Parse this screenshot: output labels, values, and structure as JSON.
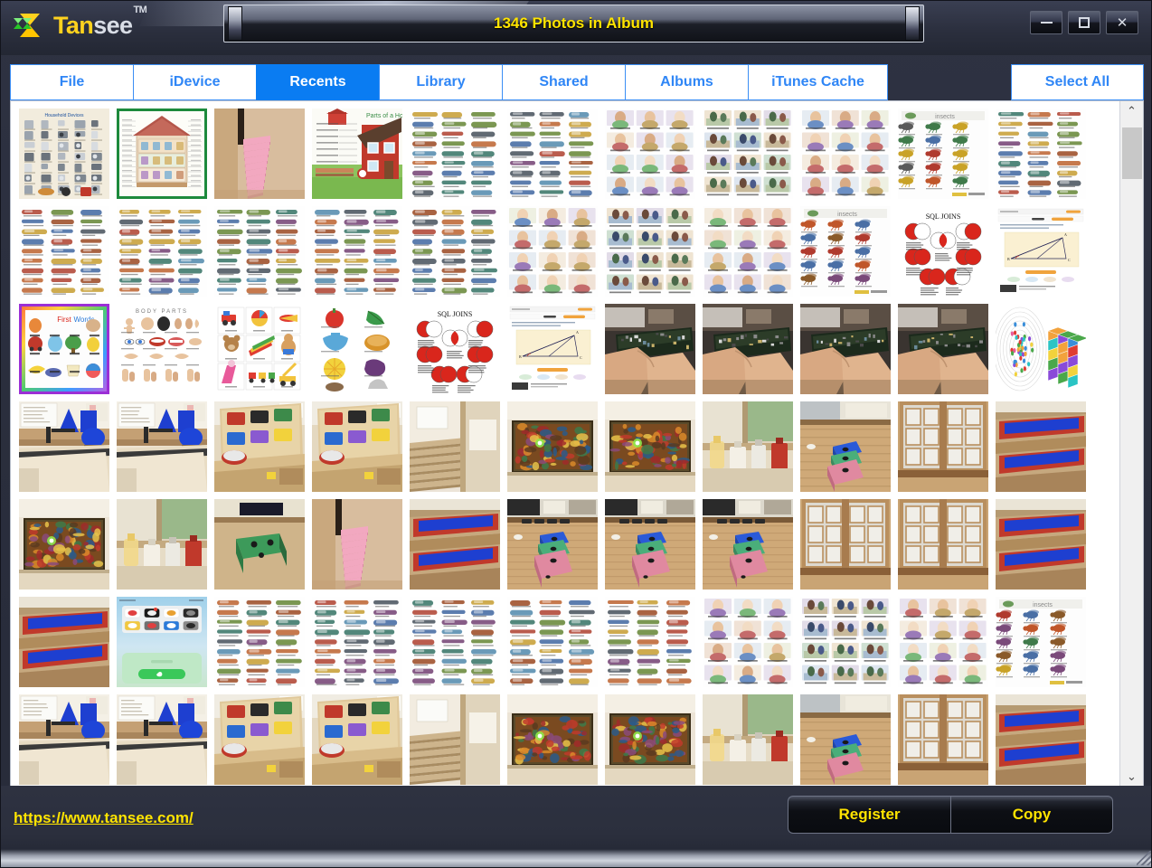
{
  "window": {
    "title": "1346 Photos in Album",
    "brand_name_part1": "Tan",
    "brand_name_part2": "see",
    "brand_tm": "TM",
    "minimize_label": "",
    "maximize_label": "",
    "close_label": "✕",
    "accent_yellow": "#ffe400",
    "accent_blue": "#0a7cf2",
    "tab_blue": "#2f86f6"
  },
  "tabs": [
    {
      "label": "File",
      "active": false
    },
    {
      "label": "iDevice",
      "active": false
    },
    {
      "label": "Recents",
      "active": true
    },
    {
      "label": "Library",
      "active": false
    },
    {
      "label": "Shared",
      "active": false
    },
    {
      "label": "Albums",
      "active": false
    },
    {
      "label": "iTunes Cache",
      "active": false
    }
  ],
  "select_all": {
    "label": "Select All"
  },
  "footer": {
    "url": "https://www.tansee.com/",
    "register_label": "Register",
    "copy_label": "Copy"
  },
  "scrollbar": {
    "up_arrow": "⌃",
    "down_arrow": "⌄",
    "thumb_position_pct": 1,
    "thumb_size_pct": 8
  },
  "grid": {
    "columns": 11,
    "rows": 7,
    "thumbnails": [
      {
        "id": "r1c1",
        "kind": "poster-appliances",
        "selected": null,
        "caption": "Household Devices and Appliances"
      },
      {
        "id": "r1c2",
        "kind": "poster-house-cut",
        "selected": "green",
        "caption": "House cutaway diagram"
      },
      {
        "id": "r1c3",
        "kind": "photo-pink-stack",
        "selected": null,
        "caption": "Pink stacking blocks"
      },
      {
        "id": "r1c4",
        "kind": "poster-parts-house",
        "selected": null,
        "caption": "Parts of a House"
      },
      {
        "id": "r1c5",
        "kind": "poster-vocab-rows",
        "selected": null,
        "caption": "Vocabulary chart"
      },
      {
        "id": "r1c6",
        "kind": "poster-vocab-rows",
        "selected": null,
        "caption": "Vocabulary chart"
      },
      {
        "id": "r1c7",
        "kind": "poster-routine",
        "selected": null,
        "caption": "Daily routine chart"
      },
      {
        "id": "r1c8",
        "kind": "poster-routine2",
        "selected": null,
        "caption": "Daily routine chart"
      },
      {
        "id": "r1c9",
        "kind": "poster-routine",
        "selected": null,
        "caption": "Daily routine chart"
      },
      {
        "id": "r1c10",
        "kind": "poster-insects",
        "selected": null,
        "caption": "Insects chart"
      },
      {
        "id": "r1c11",
        "kind": "poster-vocab-rows",
        "selected": null,
        "caption": "Vocabulary chart"
      },
      {
        "id": "r2c1",
        "kind": "poster-vocab-rows",
        "selected": null,
        "caption": "Vocabulary chart"
      },
      {
        "id": "r2c2",
        "kind": "poster-vocab-rows",
        "selected": null,
        "caption": "Vocabulary chart"
      },
      {
        "id": "r2c3",
        "kind": "poster-vocab-rows",
        "selected": null,
        "caption": "Vocabulary chart"
      },
      {
        "id": "r2c4",
        "kind": "poster-vocab-rows",
        "selected": null,
        "caption": "Vocabulary chart"
      },
      {
        "id": "r2c5",
        "kind": "poster-vocab-rows",
        "selected": null,
        "caption": "Vocabulary chart"
      },
      {
        "id": "r2c6",
        "kind": "poster-routine",
        "selected": null,
        "caption": "Daily routine chart"
      },
      {
        "id": "r2c7",
        "kind": "poster-routine2",
        "selected": null,
        "caption": "Daily routine chart"
      },
      {
        "id": "r2c8",
        "kind": "poster-routine",
        "selected": null,
        "caption": "Daily routine chart"
      },
      {
        "id": "r2c9",
        "kind": "poster-insects",
        "selected": null,
        "caption": "Insects chart"
      },
      {
        "id": "r2c10",
        "kind": "poster-sqljoins",
        "selected": null,
        "caption": "SQL Joins diagram"
      },
      {
        "id": "r2c11",
        "kind": "screen-geometry",
        "selected": null,
        "caption": "Geometry webpage"
      },
      {
        "id": "r3c1",
        "kind": "poster-firstwords",
        "selected": "purple",
        "caption": "First Words chart"
      },
      {
        "id": "r3c2",
        "kind": "poster-bodyparts",
        "selected": null,
        "caption": "Body Parts chart"
      },
      {
        "id": "r3c3",
        "kind": "poster-toys",
        "selected": null,
        "caption": "Toys flashcards"
      },
      {
        "id": "r3c4",
        "kind": "poster-objects",
        "selected": null,
        "caption": "Objects flashcards"
      },
      {
        "id": "r3c5",
        "kind": "poster-sqljoins",
        "selected": null,
        "caption": "SQL Joins diagram"
      },
      {
        "id": "r3c6",
        "kind": "screen-geometry",
        "selected": null,
        "caption": "Geometry webpage"
      },
      {
        "id": "r3c7",
        "kind": "photo-hand-board",
        "selected": null,
        "caption": "Hand holding circuit board"
      },
      {
        "id": "r3c8",
        "kind": "photo-hand-board",
        "selected": null,
        "caption": "Hand holding circuit board"
      },
      {
        "id": "r3c9",
        "kind": "photo-hand-board",
        "selected": null,
        "caption": "Hand holding circuit board"
      },
      {
        "id": "r3c10",
        "kind": "photo-hand-board",
        "selected": null,
        "caption": "Hand holding circuit board"
      },
      {
        "id": "r3c11",
        "kind": "diagram-cubes",
        "selected": null,
        "caption": "Colorful cube diagram"
      },
      {
        "id": "r4c1",
        "kind": "photo-classroom-a",
        "selected": null,
        "caption": "Classroom shelf with blue shapes"
      },
      {
        "id": "r4c2",
        "kind": "photo-classroom-a",
        "selected": null,
        "caption": "Classroom shelf with blue shapes"
      },
      {
        "id": "r4c3",
        "kind": "photo-puzzle-board",
        "selected": null,
        "caption": "Wooden puzzle board"
      },
      {
        "id": "r4c4",
        "kind": "photo-puzzle-board",
        "selected": null,
        "caption": "Wooden puzzle board"
      },
      {
        "id": "r4c5",
        "kind": "photo-stairs",
        "selected": null,
        "caption": "Stairs with wall art"
      },
      {
        "id": "r4c6",
        "kind": "photo-wall-art",
        "selected": null,
        "caption": "Framed wall painting"
      },
      {
        "id": "r4c7",
        "kind": "photo-wall-art",
        "selected": null,
        "caption": "Framed wall painting"
      },
      {
        "id": "r4c8",
        "kind": "photo-bottles",
        "selected": null,
        "caption": "Bottles on table"
      },
      {
        "id": "r4c9",
        "kind": "photo-color-cubes",
        "selected": null,
        "caption": "Colored cubes on floor"
      },
      {
        "id": "r4c10",
        "kind": "photo-cabinet",
        "selected": null,
        "caption": "Glass cabinet doors"
      },
      {
        "id": "r4c11",
        "kind": "photo-redblue-step",
        "selected": null,
        "caption": "Red and blue step blocks"
      },
      {
        "id": "r5c1",
        "kind": "photo-wall-art",
        "selected": null,
        "caption": "Framed wall painting"
      },
      {
        "id": "r5c2",
        "kind": "photo-bottles",
        "selected": null,
        "caption": "Bottles on table"
      },
      {
        "id": "r5c3",
        "kind": "photo-green-box",
        "selected": null,
        "caption": "Green box on table"
      },
      {
        "id": "r5c4",
        "kind": "photo-pink-stack",
        "selected": null,
        "caption": "Pink stacking blocks"
      },
      {
        "id": "r5c5",
        "kind": "photo-redblue-step",
        "selected": null,
        "caption": "Red and blue step blocks"
      },
      {
        "id": "r5c6",
        "kind": "photo-boxes-stack",
        "selected": null,
        "caption": "Stacked colored boxes"
      },
      {
        "id": "r5c7",
        "kind": "photo-boxes-stack",
        "selected": null,
        "caption": "Stacked colored boxes"
      },
      {
        "id": "r5c8",
        "kind": "photo-boxes-stack",
        "selected": null,
        "caption": "Stacked colored boxes"
      },
      {
        "id": "r5c9",
        "kind": "photo-cabinet",
        "selected": null,
        "caption": "Glass cabinet doors"
      },
      {
        "id": "r5c10",
        "kind": "photo-cabinet",
        "selected": null,
        "caption": "Glass cabinet doors"
      },
      {
        "id": "r5c11",
        "kind": "photo-redblue-step",
        "selected": null,
        "caption": "Red and blue step blocks"
      },
      {
        "id": "r6c1",
        "kind": "photo-redblue-step",
        "selected": null,
        "caption": "Red and blue step blocks"
      },
      {
        "id": "r6c2",
        "kind": "screen-phone-call",
        "selected": null,
        "caption": "Phone app screenshot"
      },
      {
        "id": "r6c3",
        "kind": "poster-vocab-rows",
        "selected": null,
        "caption": "Vocabulary chart"
      },
      {
        "id": "r6c4",
        "kind": "poster-vocab-rows",
        "selected": null,
        "caption": "Vocabulary chart"
      },
      {
        "id": "r6c5",
        "kind": "poster-vocab-rows",
        "selected": null,
        "caption": "Vocabulary chart"
      },
      {
        "id": "r6c6",
        "kind": "poster-vocab-rows",
        "selected": null,
        "caption": "Vocabulary chart"
      },
      {
        "id": "r6c7",
        "kind": "poster-vocab-rows",
        "selected": null,
        "caption": "Vocabulary chart"
      },
      {
        "id": "r6c8",
        "kind": "poster-routine",
        "selected": null,
        "caption": "Daily routine chart"
      },
      {
        "id": "r6c9",
        "kind": "poster-routine2",
        "selected": null,
        "caption": "Daily routine chart"
      },
      {
        "id": "r6c10",
        "kind": "poster-routine",
        "selected": null,
        "caption": "Daily routine chart"
      },
      {
        "id": "r6c11",
        "kind": "poster-insects",
        "selected": null,
        "caption": "Insects chart"
      },
      {
        "id": "r7c1",
        "kind": "photo-classroom-a",
        "selected": null,
        "caption": "Classroom shelf with blue shapes"
      },
      {
        "id": "r7c2",
        "kind": "photo-classroom-a",
        "selected": null,
        "caption": "Classroom shelf with blue shapes"
      },
      {
        "id": "r7c3",
        "kind": "photo-puzzle-board",
        "selected": null,
        "caption": "Wooden puzzle board"
      },
      {
        "id": "r7c4",
        "kind": "photo-puzzle-board",
        "selected": null,
        "caption": "Wooden puzzle board"
      },
      {
        "id": "r7c5",
        "kind": "photo-stairs",
        "selected": null,
        "caption": "Stairs with wall art"
      },
      {
        "id": "r7c6",
        "kind": "photo-wall-art",
        "selected": null,
        "caption": "Framed wall painting"
      },
      {
        "id": "r7c7",
        "kind": "photo-wall-art",
        "selected": null,
        "caption": "Framed wall painting"
      },
      {
        "id": "r7c8",
        "kind": "photo-bottles",
        "selected": null,
        "caption": "Bottles on table"
      },
      {
        "id": "r7c9",
        "kind": "photo-color-cubes",
        "selected": null,
        "caption": "Colored cubes on floor"
      },
      {
        "id": "r7c10",
        "kind": "photo-cabinet",
        "selected": null,
        "caption": "Glass cabinet doors"
      },
      {
        "id": "r7c11",
        "kind": "photo-redblue-step",
        "selected": null,
        "caption": "Red and blue step blocks"
      }
    ]
  }
}
